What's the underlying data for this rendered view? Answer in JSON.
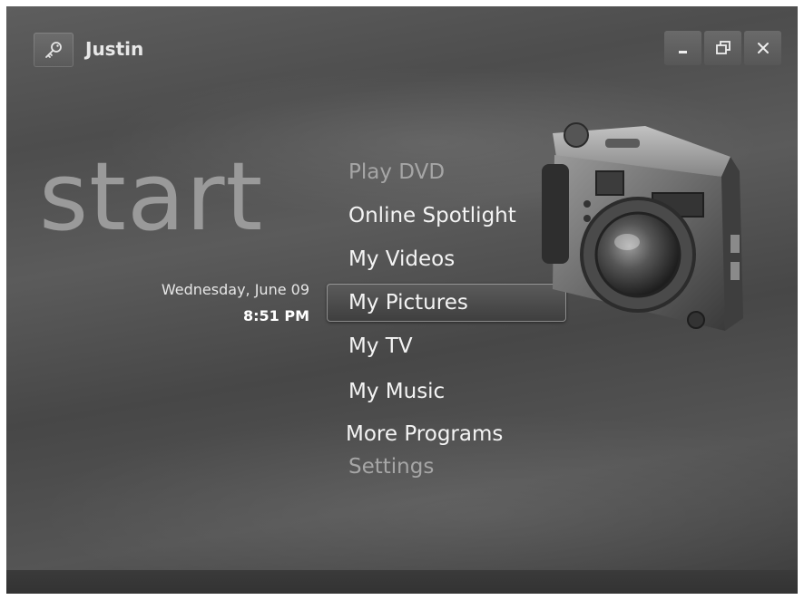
{
  "user": {
    "name": "Justin",
    "icon": "key-icon"
  },
  "window_controls": {
    "minimize_icon": "minimize-icon",
    "restore_icon": "restore-icon",
    "close_icon": "close-icon"
  },
  "start_label": "start",
  "clock": {
    "date": "Wednesday, June 09",
    "time": "8:51 PM"
  },
  "menu": {
    "items": [
      {
        "label": "Play DVD",
        "dim": true
      },
      {
        "label": "Online Spotlight"
      },
      {
        "label": "My Videos"
      },
      {
        "label": "My Pictures",
        "selected": true
      },
      {
        "label": "My TV"
      },
      {
        "label": "My Music"
      },
      {
        "label": "More Programs"
      },
      {
        "label": "Settings",
        "dim": true
      }
    ]
  },
  "illustration": "camera-icon"
}
